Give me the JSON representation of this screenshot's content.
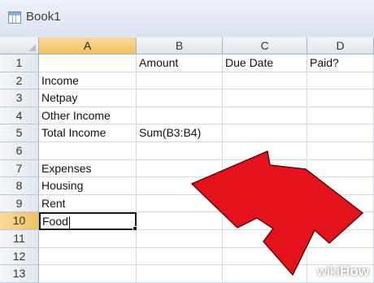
{
  "window": {
    "title": "Book1"
  },
  "columns": [
    "A",
    "B",
    "C",
    "D"
  ],
  "rows": [
    "1",
    "2",
    "3",
    "4",
    "5",
    "6",
    "7",
    "8",
    "9",
    "10",
    "11",
    "12",
    "13"
  ],
  "cells": {
    "B1": "Amount",
    "C1": "Due Date",
    "D1": "Paid?",
    "A2": "Income",
    "A3": "Netpay",
    "A4": "Other Income",
    "A5": "Total Income",
    "B5": "Sum(B3:B4)",
    "A7": "Expenses",
    "A8": "Housing",
    "A9": "Rent",
    "A10": "Food"
  },
  "selection": {
    "cell": "A10",
    "row": "10",
    "column": "A"
  },
  "watermark": {
    "prefix": "wiki",
    "suffix": "How"
  },
  "colors": {
    "arrow": "#e4121b",
    "header_active": "#f1c15f",
    "gridline": "#d0d7e5"
  }
}
